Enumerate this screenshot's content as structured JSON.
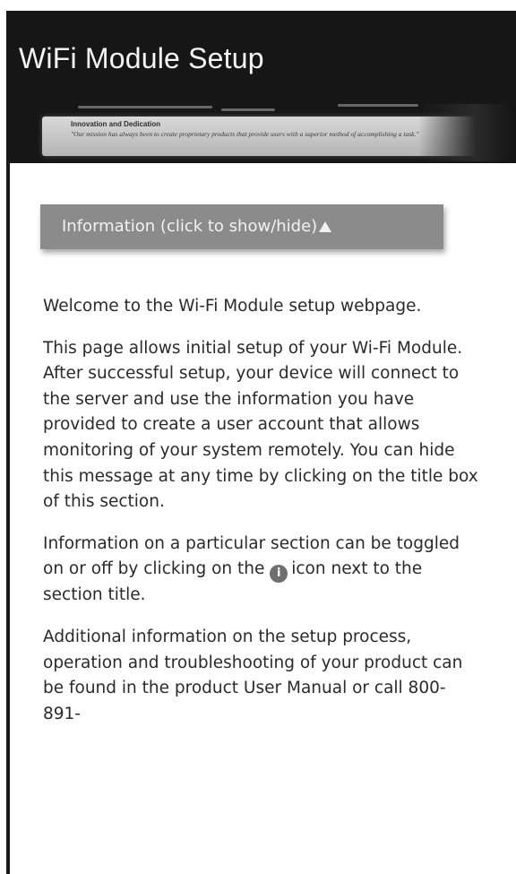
{
  "header": {
    "title": "WiFi Module Setup",
    "banner": {
      "heading": "Innovation and Dedication",
      "quote": "\"Our mission has always been to create proprietary products that provide users with a superior method of accomplishing a task.\""
    }
  },
  "info_section": {
    "toggle_label": "Information (click to show/hide)",
    "toggle_icon": "caret-up-icon",
    "paragraphs": {
      "p1": "Welcome to the Wi-Fi Module setup webpage.",
      "p2": "This page allows initial setup of your Wi-Fi Module. After successful setup, your device will connect to the server and use the information you have provided to create a user account that allows monitoring of your system remotely. You can hide this message at any time by clicking on the title box of this section.",
      "p3_before": "Information on a particular section can be toggled on or off by clicking on the",
      "p3_icon": "i",
      "p3_after": "icon next to the section title.",
      "p4": "Additional information on the setup process, operation and troubleshooting of your product can be found in the product User Manual or call 800-891-"
    }
  }
}
